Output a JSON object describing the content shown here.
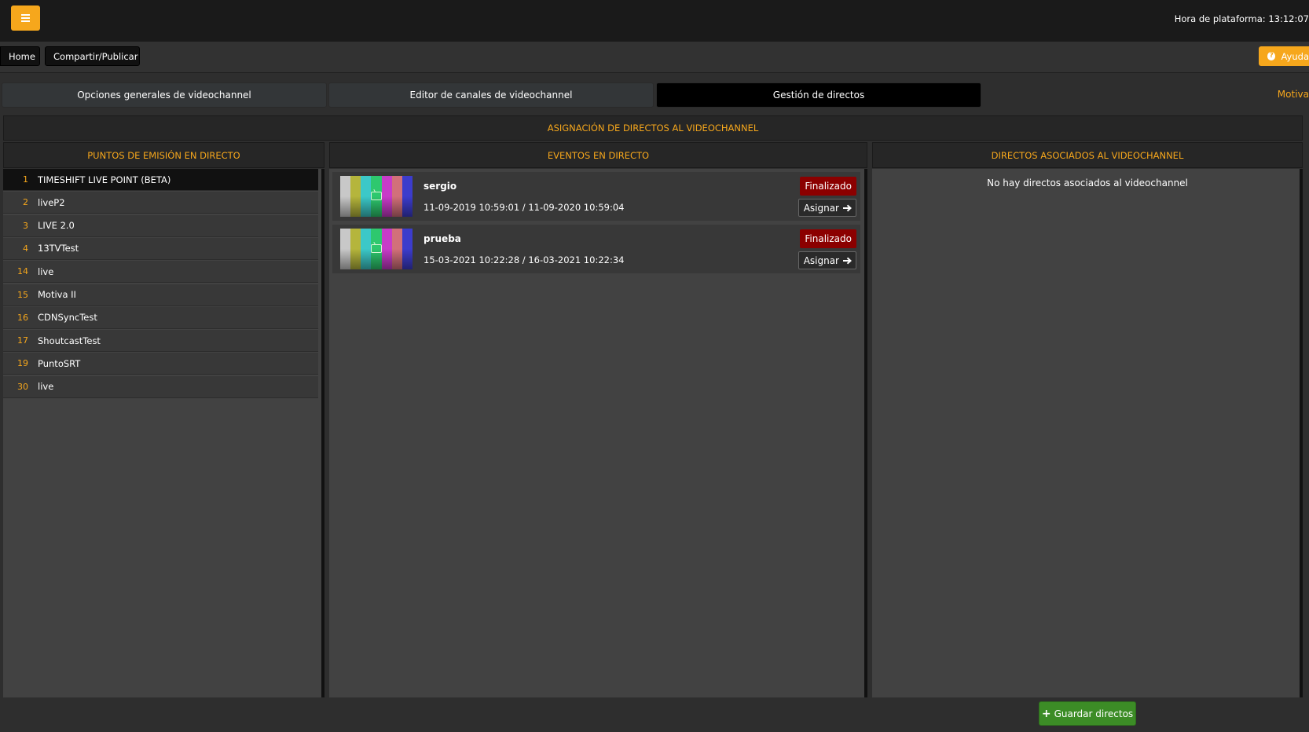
{
  "topbar": {
    "menu_icon": "hamburger-icon",
    "clock_text": "Hora de plataforma: 13:12:07"
  },
  "toolbar": {
    "home_label": "Home",
    "share_label": "Compartir/Publicar",
    "help_label": "Ayuda"
  },
  "tabs": [
    {
      "label": "Opciones generales de videochannel"
    },
    {
      "label": "Editor de canales de videochannel"
    },
    {
      "label": "Gestión de directos"
    }
  ],
  "tab_extra": "Motiva",
  "section_title": "ASIGNACIÓN DE DIRECTOS AL VIDEOCHANNEL",
  "columns": {
    "live_points": "PUNTOS DE EMISIÓN EN DIRECTO",
    "events": "EVENTOS EN DIRECTO",
    "associated": "DIRECTOS ASOCIADOS AL VIDEOCHANNEL"
  },
  "live_points": [
    {
      "id": "1",
      "name": "TIMESHIFT LIVE POINT (BETA)"
    },
    {
      "id": "2",
      "name": "liveP2"
    },
    {
      "id": "3",
      "name": "LIVE 2.0"
    },
    {
      "id": "4",
      "name": "13TVTest"
    },
    {
      "id": "14",
      "name": "live"
    },
    {
      "id": "15",
      "name": "Motiva II"
    },
    {
      "id": "16",
      "name": "CDNSyncTest"
    },
    {
      "id": "17",
      "name": "ShoutcastTest"
    },
    {
      "id": "19",
      "name": "PuntoSRT"
    },
    {
      "id": "30",
      "name": "live"
    }
  ],
  "events": [
    {
      "name": "sergio",
      "dates": "11-09-2019 10:59:01 / 11-09-2020 10:59:04",
      "status": "Finalizado",
      "action": "Asignar"
    },
    {
      "name": "prueba",
      "dates": "15-03-2021 10:22:28 / 16-03-2021 10:22:34",
      "status": "Finalizado",
      "action": "Asignar"
    }
  ],
  "associated_empty": "No hay directos asociados al videochannel",
  "save_label": "Guardar directos",
  "colors": {
    "accent": "#f6a71c",
    "status_finished": "#8b0000",
    "save_green": "#3c8c26",
    "test_pattern": [
      "#c8c8c8",
      "#b5b53c",
      "#3cc8c8",
      "#2ec86e",
      "#c83cc8",
      "#d2707a",
      "#3c3ccc"
    ]
  }
}
